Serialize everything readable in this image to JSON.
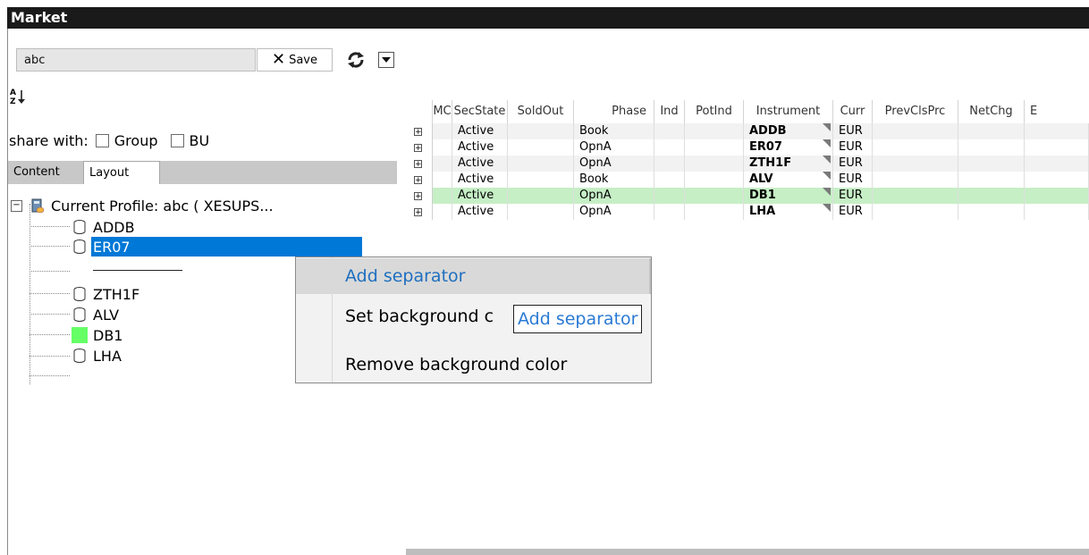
{
  "window": {
    "title": "Market"
  },
  "search": {
    "value": "abc",
    "save_label": "Save"
  },
  "share": {
    "label": "share with:",
    "options": [
      "Group",
      "BU"
    ]
  },
  "tabs": [
    {
      "label": "Content"
    },
    {
      "label": "Layout"
    }
  ],
  "tree": {
    "root": "Current Profile: abc ( XESUPS...",
    "items": [
      "ADDB",
      "ER07",
      "ZTH1F",
      "ALV",
      "DB1",
      "LHA"
    ],
    "selected": "ER07",
    "highlight_color": "#66ff66"
  },
  "grid": {
    "columns": [
      "",
      "MC",
      "SecState",
      "SoldOut",
      "Phase",
      "Ind",
      "PotInd",
      "Instrument",
      "Curr",
      "PrevClsPrc",
      "NetChg",
      "E"
    ],
    "rows": [
      {
        "SecState": "Active",
        "Phase": "Book",
        "Instrument": "ADDB",
        "Curr": "EUR"
      },
      {
        "SecState": "Active",
        "Phase": "OpnA",
        "Instrument": "ER07",
        "Curr": "EUR"
      },
      {
        "SecState": "Active",
        "Phase": "OpnA",
        "Instrument": "ZTH1F",
        "Curr": "EUR"
      },
      {
        "SecState": "Active",
        "Phase": "Book",
        "Instrument": "ALV",
        "Curr": "EUR"
      },
      {
        "SecState": "Active",
        "Phase": "OpnA",
        "Instrument": "DB1",
        "Curr": "EUR"
      },
      {
        "SecState": "Active",
        "Phase": "OpnA",
        "Instrument": "LHA",
        "Curr": "EUR"
      }
    ],
    "highlight_row_color": "#c6efc6"
  },
  "context_menu": {
    "items": [
      "Add separator",
      "Set background c",
      "Remove background color"
    ],
    "tooltip": "Add separator"
  },
  "colors": {
    "accent": "#0078d7",
    "titlebar": "#1a1a1a"
  }
}
